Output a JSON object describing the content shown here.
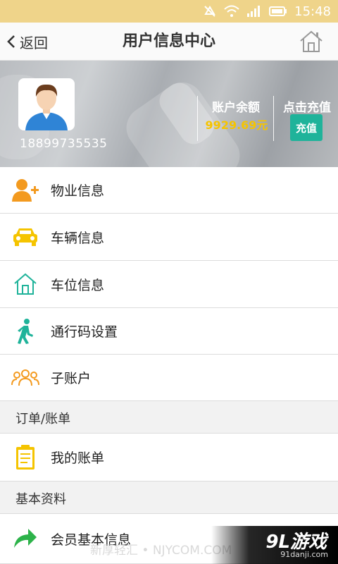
{
  "status_bar": {
    "time": "15:48"
  },
  "nav": {
    "back_label": "返回",
    "title": "用户信息中心"
  },
  "profile": {
    "phone": "18899735535",
    "balance_label": "账户余额",
    "balance_value": "9929.69元",
    "recharge_label": "点击充值",
    "recharge_button": "充值"
  },
  "menu": {
    "property_info": "物业信息",
    "vehicle_info": "车辆信息",
    "parking_info": "车位信息",
    "passcode_settings": "通行码设置",
    "sub_accounts": "子账户",
    "orders_section": "订单/账单",
    "my_bills": "我的账单",
    "basic_section": "基本资料",
    "member_info": "会员基本信息"
  },
  "watermark": {
    "logo": "9L游戏",
    "site": "91danji.com",
    "text": "新厚轻汇 • NJYCOM.COM"
  },
  "colors": {
    "status_bar": "#efd48a",
    "accent_teal": "#1fb39a",
    "accent_orange": "#f39a1f",
    "accent_yellow": "#f5c400",
    "accent_green": "#2db34a",
    "balance_text": "#f5c400"
  }
}
